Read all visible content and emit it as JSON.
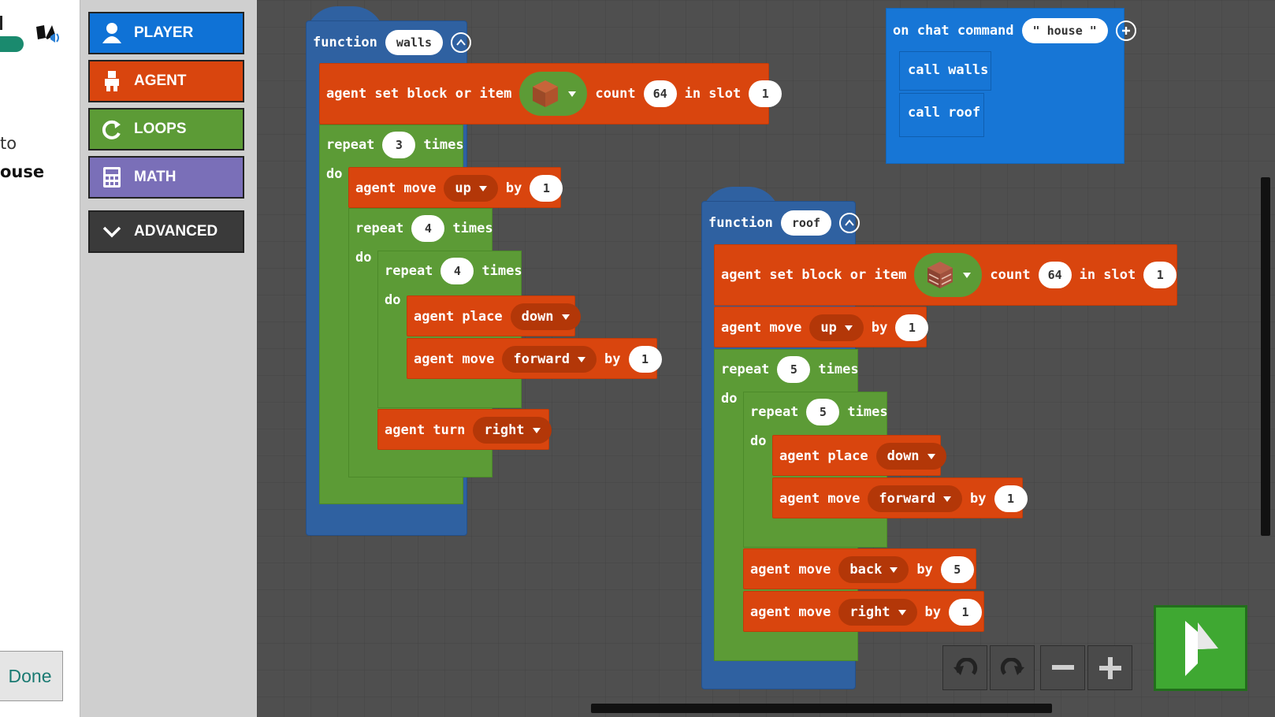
{
  "left_panel": {
    "line1": "to",
    "line2": "ouse",
    "done_label": "Done"
  },
  "toolbox": {
    "categories": [
      {
        "label": "PLAYER",
        "color": "#0f72d6"
      },
      {
        "label": "AGENT",
        "color": "#d9450e"
      },
      {
        "label": "LOOPS",
        "color": "#5c9b36"
      },
      {
        "label": "MATH",
        "color": "#7a6fb8"
      },
      {
        "label": "ADVANCED",
        "color": "#3a3a3a"
      }
    ]
  },
  "blocks": {
    "chat": {
      "label": "on chat command",
      "command": "house",
      "call1": "call walls",
      "call2": "call roof"
    },
    "walls": {
      "kw_function": "function",
      "name": "walls",
      "set_block": {
        "label": "agent set block or item",
        "count_kw": "count",
        "count": "64",
        "slot_kw": "in slot",
        "slot": "1"
      },
      "repeat1": {
        "kw": "repeat",
        "n": "3",
        "times": "times",
        "do": "do"
      },
      "move_up": {
        "label": "agent move",
        "dir": "up",
        "by": "by",
        "n": "1"
      },
      "repeat2": {
        "kw": "repeat",
        "n": "4",
        "times": "times",
        "do": "do"
      },
      "repeat3": {
        "kw": "repeat",
        "n": "4",
        "times": "times",
        "do": "do"
      },
      "place": {
        "label": "agent place",
        "dir": "down"
      },
      "move_fwd": {
        "label": "agent move",
        "dir": "forward",
        "by": "by",
        "n": "1"
      },
      "turn": {
        "label": "agent turn",
        "dir": "right"
      }
    },
    "roof": {
      "kw_function": "function",
      "name": "roof",
      "set_block": {
        "label": "agent set block or item",
        "count_kw": "count",
        "count": "64",
        "slot_kw": "in slot",
        "slot": "1"
      },
      "move_up": {
        "label": "agent move",
        "dir": "up",
        "by": "by",
        "n": "1"
      },
      "repeat1": {
        "kw": "repeat",
        "n": "5",
        "times": "times",
        "do": "do"
      },
      "repeat2": {
        "kw": "repeat",
        "n": "5",
        "times": "times",
        "do": "do"
      },
      "place": {
        "label": "agent place",
        "dir": "down"
      },
      "move_fwd": {
        "label": "agent move",
        "dir": "forward",
        "by": "by",
        "n": "1"
      },
      "move_back": {
        "label": "agent move",
        "dir": "back",
        "by": "by",
        "n": "5"
      },
      "move_right": {
        "label": "agent move",
        "dir": "right",
        "by": "by",
        "n": "1"
      }
    }
  },
  "controls": {
    "icons": [
      "undo-icon",
      "redo-icon",
      "zoom-out-icon",
      "zoom-in-icon",
      "run-icon"
    ]
  }
}
